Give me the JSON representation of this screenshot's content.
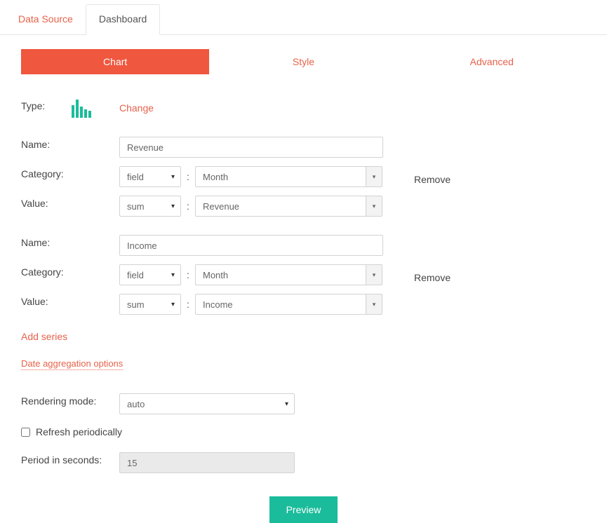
{
  "topTabs": {
    "dataSource": "Data Source",
    "dashboard": "Dashboard"
  },
  "subTabs": {
    "chart": "Chart",
    "style": "Style",
    "advanced": "Advanced"
  },
  "labels": {
    "type": "Type:",
    "change": "Change",
    "name": "Name:",
    "category": "Category:",
    "value": "Value:",
    "remove": "Remove",
    "addSeries": "Add series",
    "dateAggregation": "Date aggregation options",
    "renderingMode": "Rendering mode:",
    "refreshPeriodically": "Refresh periodically",
    "periodSeconds": "Period in seconds:",
    "preview": "Preview"
  },
  "series": [
    {
      "name": "Revenue",
      "categoryType": "field",
      "categoryField": "Month",
      "valueType": "sum",
      "valueField": "Revenue"
    },
    {
      "name": "Income",
      "categoryType": "field",
      "categoryField": "Month",
      "valueType": "sum",
      "valueField": "Income"
    }
  ],
  "renderingMode": "auto",
  "refreshPeriodically": false,
  "periodSeconds": "15"
}
